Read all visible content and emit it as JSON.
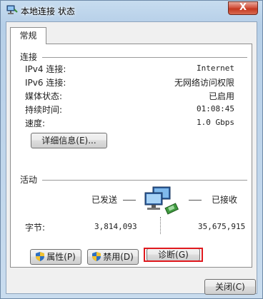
{
  "window": {
    "title": "本地连接 状态",
    "close_label": "X"
  },
  "tabs": [
    {
      "label": "常规"
    }
  ],
  "connection": {
    "heading": "连接",
    "rows": [
      {
        "label": "IPv4 连接:",
        "value": "Internet"
      },
      {
        "label": "IPv6 连接:",
        "value": "无网络访问权限"
      },
      {
        "label": "媒体状态:",
        "value": "已启用"
      },
      {
        "label": "持续时间:",
        "value": "01:08:45"
      },
      {
        "label": "速度:",
        "value": "1.0 Gbps"
      }
    ],
    "details_button": "详细信息(E)..."
  },
  "activity": {
    "heading": "活动",
    "sent_label": "已发送",
    "received_label": "已接收",
    "bytes_label": "字节:",
    "bytes_sent": "3,814,093",
    "bytes_received": "35,675,915"
  },
  "buttons": {
    "properties": "属性(P)",
    "disable": "禁用(D)",
    "diagnose": "诊断(G)",
    "close": "关闭(C)"
  },
  "colors": {
    "highlight": "#e0191e",
    "window_frame": "#b6cfe8"
  }
}
